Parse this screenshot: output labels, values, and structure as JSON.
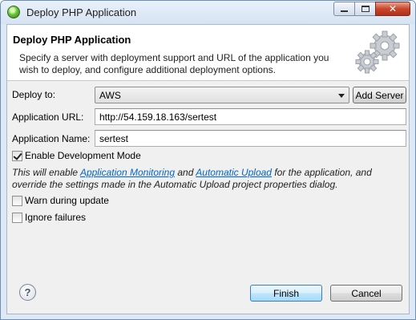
{
  "window": {
    "title": "Deploy PHP Application"
  },
  "header": {
    "title": "Deploy PHP Application",
    "description": "Specify a server with deployment support and URL of the application you wish to deploy, and configure additional deployment options."
  },
  "form": {
    "deploy_to_label": "Deploy to:",
    "deploy_to_value": "AWS",
    "add_server_label": "Add Server",
    "app_url_label": "Application URL:",
    "app_url_value": "http://54.159.18.163/sertest",
    "app_name_label": "Application Name:",
    "app_name_value": "sertest",
    "dev_mode_label": "Enable Development Mode",
    "dev_mode_checked": true,
    "info": {
      "part1": "This will enable ",
      "link1": "Application Monitoring",
      "part2": " and ",
      "link2": "Automatic Upload",
      "part3": " for the application, and override the settings made in the Automatic Upload project properties dialog."
    },
    "warn_label": "Warn during update",
    "warn_checked": false,
    "ignore_label": "Ignore failures",
    "ignore_checked": false
  },
  "footer": {
    "help_symbol": "?",
    "finish_label": "Finish",
    "cancel_label": "Cancel"
  },
  "icons": [
    "app-icon",
    "minimize-icon",
    "maximize-icon",
    "close-icon",
    "gears-icon",
    "dropdown-arrow-icon",
    "help-icon",
    "checkmark-icon"
  ],
  "colors": {
    "link": "#0066cc",
    "titlebar": "#dfe9f5",
    "close_button": "#c9462c"
  }
}
